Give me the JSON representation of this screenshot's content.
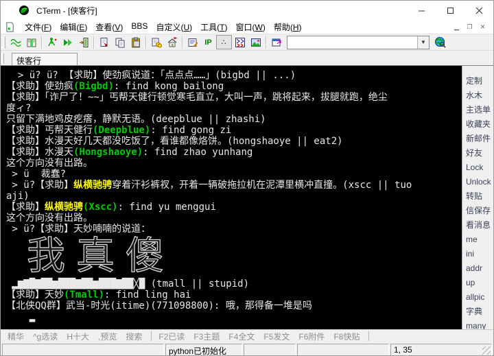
{
  "window": {
    "title": "CTerm - [侠客行]",
    "controls": [
      "minimize",
      "maximize",
      "close"
    ]
  },
  "menu": {
    "items": [
      {
        "label": "文件",
        "key": "F"
      },
      {
        "label": "编辑",
        "key": "E"
      },
      {
        "label": "查看",
        "key": "V"
      },
      {
        "label": "BBS",
        "key": ""
      },
      {
        "label": "自定义",
        "key": "U"
      },
      {
        "label": "工具",
        "key": "T"
      },
      {
        "label": "窗口",
        "key": "W"
      },
      {
        "label": "帮助",
        "key": "H"
      }
    ],
    "mdi_controls": [
      "minimize",
      "restore",
      "close"
    ]
  },
  "toolbar": {
    "icons": [
      "connect-icon",
      "address-book-icon",
      "disconnect-icon",
      "reconnect-icon",
      "exit-icon",
      "copy-url-icon",
      "copy-icon",
      "paste-icon",
      "accounts-icon",
      "home-icon",
      "edit-script-icon",
      "ip-icon",
      "dots-icon",
      "ansi-download-icon",
      "picture-icon",
      "new-window-icon"
    ],
    "address_value": "",
    "search_icon": "globe-search-icon"
  },
  "tab": {
    "label": "侠客行"
  },
  "terminal": {
    "colors": {
      "fg": "#e8e8e8",
      "green": "#00cc00",
      "yellow": "#ffff00",
      "bg": "#000000"
    },
    "art": "我真傻",
    "lines": [
      {
        "s": [
          [
            "w",
            "  > ü? ü? 【求助】使劲疯说道：「点点点……」(bigbd || ...)"
          ]
        ]
      },
      {
        "s": [
          [
            "w",
            "【求助】使劲疯"
          ],
          [
            "g",
            "(Bigbd)"
          ],
          [
            "w",
            ": find kong bailong"
          ]
        ]
      },
      {
        "s": [
          [
            "w",
            "【求助】「诈尸了！~~」丐帮天健行顿觉寒毛直立，大叫一声，跳将起来，拔腿就跑，绝尘"
          ]
        ]
      },
      {
        "s": [
          [
            "w",
            "度ィ?"
          ]
        ]
      },
      {
        "s": [
          [
            "w",
            "只留下满地鸡皮疙瘩，静默无语。(deepblue || zhashi)"
          ]
        ]
      },
      {
        "s": [
          [
            "w",
            "【求助】丐帮天健行"
          ],
          [
            "g",
            "(Deepblue)"
          ],
          [
            "w",
            ": find gong zi"
          ]
        ]
      },
      {
        "s": [
          [
            "w",
            "【求助】水漫天好几天都没吃饭了，看谁都像烙饼。(hongshaoye || eat2)"
          ]
        ]
      },
      {
        "s": [
          [
            "w",
            "【求助】水漫天"
          ],
          [
            "g",
            "(Hongshaoye)"
          ],
          [
            "w",
            ": find zhao yunhang"
          ]
        ]
      },
      {
        "s": [
          [
            "w",
            "这个方向没有出路。"
          ]
        ]
      },
      {
        "s": [
          [
            "w",
            " > ü  裁蠢?"
          ]
        ]
      },
      {
        "s": [
          [
            "w",
            " > ü?【求助】"
          ],
          [
            "y",
            "纵横驰骋"
          ],
          [
            "w",
            "穿着汗衫裤衩，开着一辆破拖拉机在泥潭里横冲直撞。(xscc || tuo"
          ]
        ]
      },
      {
        "s": [
          [
            "w",
            "aji)"
          ]
        ]
      },
      {
        "s": [
          [
            "w",
            "【求助】"
          ],
          [
            "y",
            "纵横驰骋"
          ],
          [
            "g",
            "(Xscc)"
          ],
          [
            "w",
            ": find yu menggui"
          ]
        ]
      },
      {
        "s": [
          [
            "w",
            "这个方向没有出路。"
          ]
        ]
      },
      {
        "s": [
          [
            "w",
            " > ü?【求助】天妙喃喃的说道："
          ]
        ]
      },
      {
        "art": true
      },
      {
        "s": [
          [
            "w",
            " ▂▆▇█▇██▆███▇██▆███▇██╳█ (tmall || stupid)"
          ]
        ]
      },
      {
        "s": [
          [
            "w",
            "【求助】天妙"
          ],
          [
            "g",
            "(Tmall)"
          ],
          [
            "w",
            ": find ling hai"
          ]
        ]
      },
      {
        "s": [
          [
            "w",
            "【北侠QQ群】武当-时光(itime)(771098800): 哦，那得备一堆是吗"
          ]
        ]
      },
      {
        "s": [
          [
            "w",
            "    ▂"
          ]
        ]
      }
    ]
  },
  "sidebar": {
    "items": [
      "定制",
      "水木",
      "主选单",
      "收藏夹",
      "新邮件",
      "好友",
      "Lock",
      "Unlock",
      "转贴",
      "信保存",
      "看消息",
      "me",
      "ini",
      "addr",
      "up",
      "allpic",
      "字典",
      "many"
    ]
  },
  "fkeybar": {
    "left": [
      "精华",
      "^g选读",
      "H十大",
      ",预览",
      "搜索"
    ],
    "right": [
      "F2已读",
      "F3主题",
      "F4全文",
      "F5发文",
      "F6附件",
      "F8快贴"
    ]
  },
  "statusbar": {
    "panels": [
      "",
      "python已初始化",
      "",
      "",
      "1, 35"
    ]
  }
}
